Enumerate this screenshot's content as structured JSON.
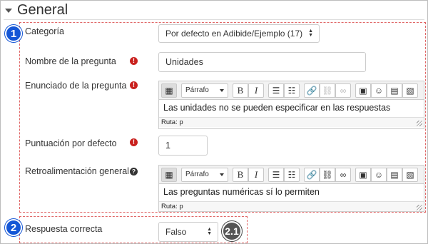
{
  "section": {
    "title": "General"
  },
  "badges": {
    "one": "1",
    "two": "2",
    "two_one": "2.1"
  },
  "fields": {
    "categoria": {
      "label": "Categoría",
      "value": "Por defecto en Adibide/Ejemplo (17)"
    },
    "nombre": {
      "label": "Nombre de la pregunta",
      "value": "Unidades"
    },
    "enunciado": {
      "label": "Enunciado de la pregunta",
      "content": "Las unidades no se pueden especificar en las respuestas",
      "path": "Ruta: p"
    },
    "puntuacion": {
      "label": "Puntuación por defecto",
      "value": "1"
    },
    "retro": {
      "label": "Retroalimentación general",
      "content": "Las preguntas numéricas sí lo permiten",
      "path": "Ruta: p"
    },
    "respuesta": {
      "label": "Respuesta correcta",
      "value": "Falso"
    }
  },
  "toolbar": {
    "format": "Párrafo",
    "bold": "B",
    "italic": "I"
  },
  "icons": {
    "required": "exclamation-circle",
    "help": "question-circle"
  },
  "colors": {
    "badge_blue": "#1456d6",
    "required_red": "#c9211e",
    "dash_red": "#e06666"
  }
}
